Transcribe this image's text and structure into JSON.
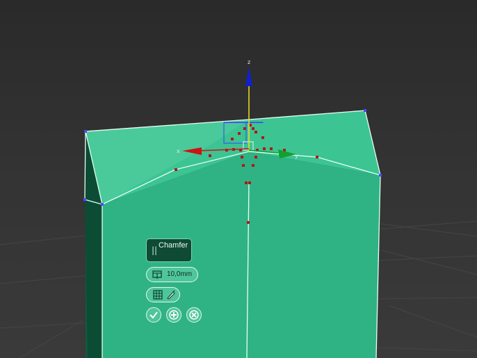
{
  "viewport": {
    "background": "#2f2f2f",
    "mesh_color": "#2fb384",
    "edge_color": "#e6fff4",
    "selection_color": "#b01818",
    "gizmo": {
      "x_label": "x",
      "y_label": "y",
      "z_label": "z",
      "x_color": "#d01212",
      "y_color": "#12a030",
      "z_color": "#1020d0"
    }
  },
  "caddy": {
    "title": "Chamfer",
    "grip_glyph": "||",
    "amount_value": "10,0mm",
    "amount_icon": "chamfer-amount-icon",
    "options": [
      {
        "icon": "segments-grid-icon"
      },
      {
        "icon": "smooth-brush-icon"
      }
    ],
    "actions": [
      {
        "name": "ok",
        "icon": "checkmark-icon"
      },
      {
        "name": "apply-continue",
        "icon": "plus-icon"
      },
      {
        "name": "cancel",
        "icon": "x-icon"
      }
    ]
  }
}
